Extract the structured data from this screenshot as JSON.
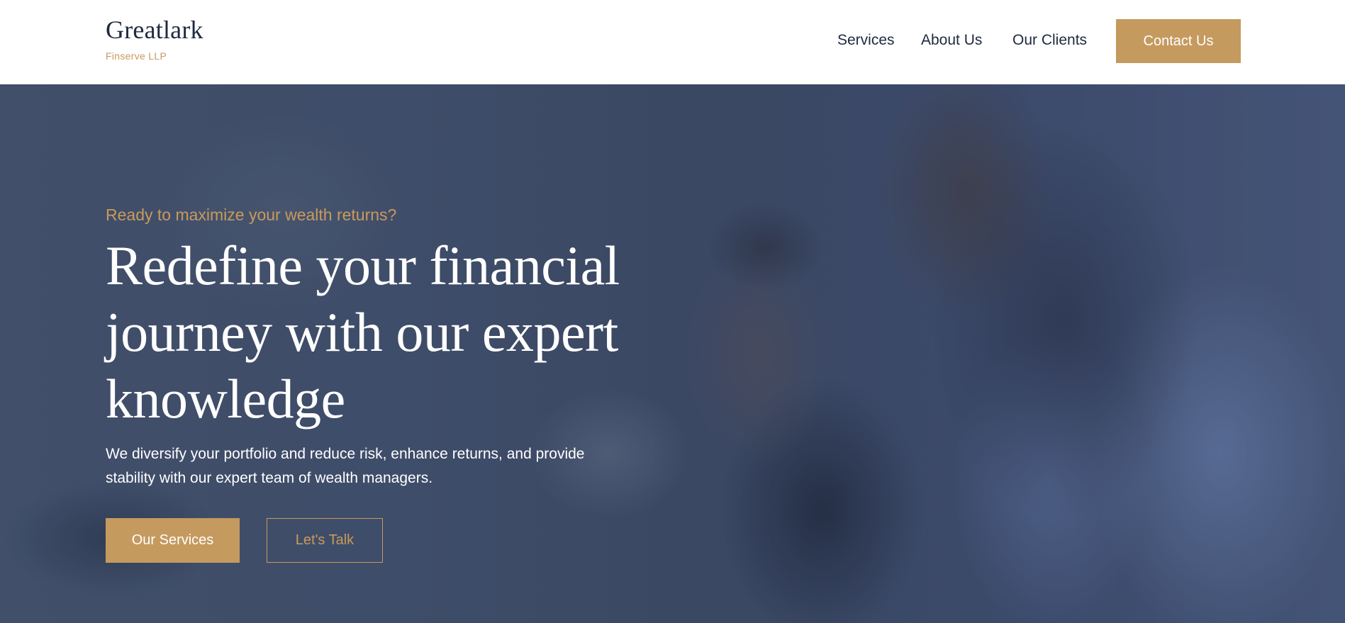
{
  "header": {
    "logo": {
      "name": "Greatlark",
      "subtitle": "Finserve LLP"
    },
    "nav": [
      {
        "label": "Services"
      },
      {
        "label": "About Us"
      },
      {
        "label": "Our Clients"
      }
    ],
    "cta_label": "Contact Us"
  },
  "hero": {
    "eyebrow": "Ready to maximize your wealth returns?",
    "headline": "Redefine your financial journey with our expert knowledge",
    "subtext": "We diversify your portfolio and reduce risk, enhance returns, and provide stability with our expert team of wealth managers.",
    "primary_button": "Our Services",
    "secondary_button": "Let's Talk"
  },
  "colors": {
    "brand_navy": "#1e2a3f",
    "accent_gold": "#c59a5f",
    "hero_overlay": "#3c4a66"
  }
}
